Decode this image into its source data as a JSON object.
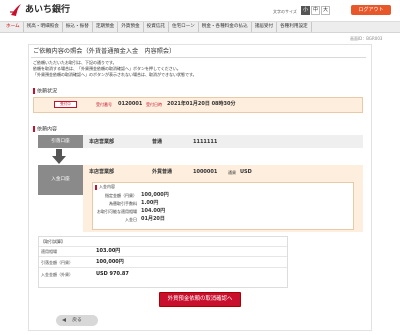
{
  "header": {
    "bank_name": "あいち銀行",
    "fontsize_label": "文字のサイズ",
    "fontsize_small": "小",
    "fontsize_mid": "中",
    "fontsize_large": "大",
    "logout": "ログアウト"
  },
  "nav": {
    "items": [
      "ホーム",
      "残高・明細照会",
      "振込・振替",
      "定期預金",
      "外貨預金",
      "投資信託",
      "住宅ローン",
      "税金・各種料金の払込",
      "諸届受付",
      "各種利用設定"
    ]
  },
  "screen_id": "画面ID：BGR003",
  "page_title": "ご依頼内容の照会（外貨普通預金入金　内容照会）",
  "intro": [
    "ご依頼いただいたお取引は、下記の通りです。",
    "依頼を取消する場合は、「外貨預金依頼の取消確認へ」ボタンを押してください。",
    "「外貨預金依頼の取消確認へ」のボタンが表示されない場合は、取消ができない状態です。"
  ],
  "status_section": {
    "heading": "依頼状況",
    "badge": "受付中",
    "receipt_no_label": "受付番号",
    "receipt_no": "0120001",
    "datetime_label": "受付日時",
    "datetime": "2021年01月20日 08時30分"
  },
  "detail_section": {
    "heading": "依頼内容",
    "from_tag": "引落口座",
    "from_branch": "本店営業部",
    "from_type": "普通",
    "from_account": "1111111",
    "to_tag": "入金口座",
    "to_branch": "本店営業部",
    "to_type": "外貨普通",
    "to_account": "1000001",
    "currency_label": "通貨",
    "currency": "USD",
    "deposit_heading": "入金内容",
    "rows": [
      {
        "label": "指定金額（円貨）",
        "value": "100,000円"
      },
      {
        "label": "為替取引手数料",
        "value": "1.00円"
      },
      {
        "label": "お取引可能な適用相場",
        "value": "104.00円"
      },
      {
        "label": "入金日",
        "value": "01月20日"
      }
    ]
  },
  "conversion": {
    "heading": "【取引試算】",
    "rows": [
      {
        "label": "適用相場",
        "value": "103.00円"
      },
      {
        "label": "引落金額（円貨）",
        "value": "100,000円"
      },
      {
        "label": "入金金額（外貨）",
        "value": "USD 970.87"
      }
    ]
  },
  "buttons": {
    "confirm": "外貨預金依頼の取消確認へ",
    "back": "戻る"
  },
  "colors": {
    "accent": "#c8102e",
    "logout": "#e8572a",
    "highlight_bg": "#fdeedd"
  }
}
